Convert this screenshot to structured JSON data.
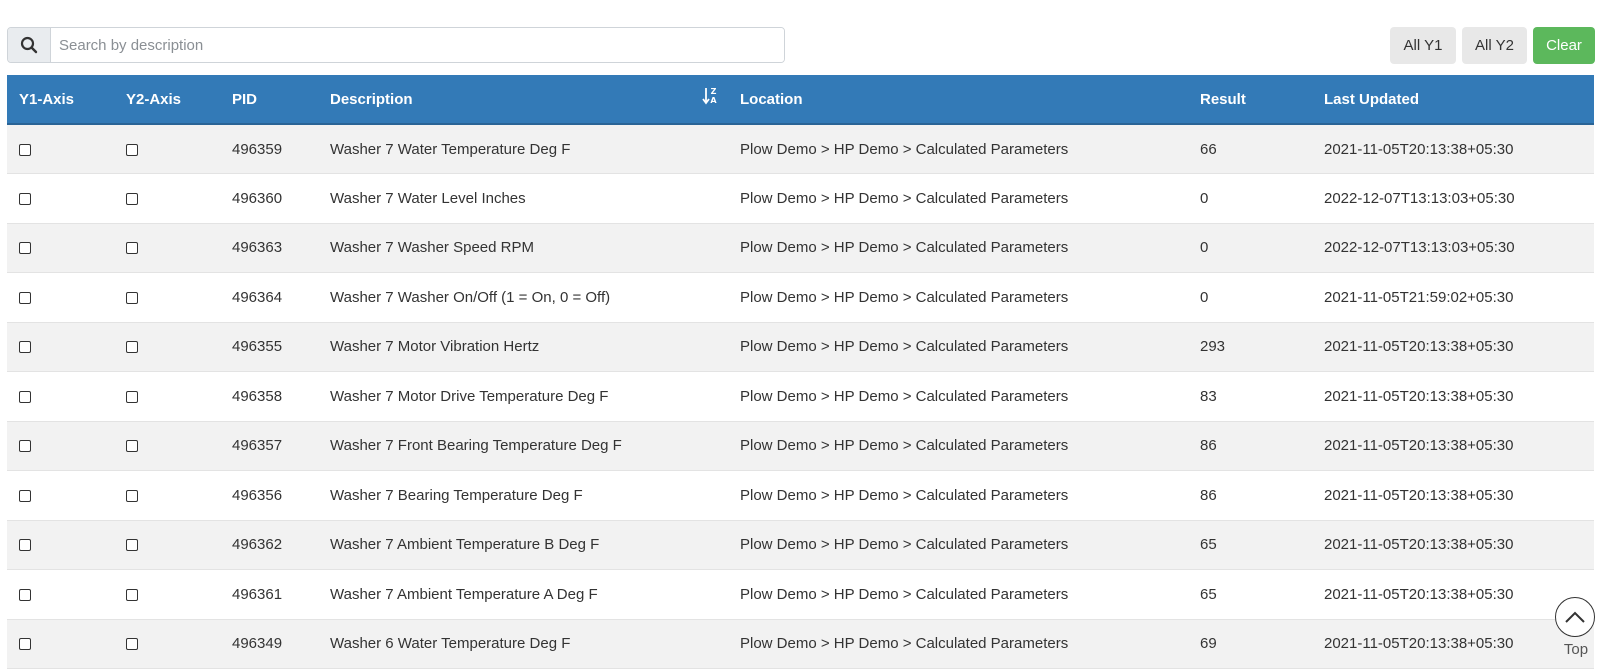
{
  "search": {
    "placeholder": "Search by description",
    "value": ""
  },
  "toolbar": {
    "all_y1_label": "All Y1",
    "all_y2_label": "All Y2",
    "clear_label": "Clear"
  },
  "table": {
    "headers": [
      "Y1-Axis",
      "Y2-Axis",
      "PID",
      "Description",
      "Location",
      "Result",
      "Last Updated"
    ],
    "sorted_column": "Description",
    "sort_direction": "descending",
    "rows": [
      {
        "pid": "496359",
        "description": "Washer 7 Water Temperature Deg F",
        "location": "Plow Demo > HP Demo > Calculated Parameters",
        "result": "66",
        "last_updated": "2021-11-05T20:13:38+05:30"
      },
      {
        "pid": "496360",
        "description": "Washer 7 Water Level Inches",
        "location": "Plow Demo > HP Demo > Calculated Parameters",
        "result": "0",
        "last_updated": "2022-12-07T13:13:03+05:30"
      },
      {
        "pid": "496363",
        "description": "Washer 7 Washer Speed RPM",
        "location": "Plow Demo > HP Demo > Calculated Parameters",
        "result": "0",
        "last_updated": "2022-12-07T13:13:03+05:30"
      },
      {
        "pid": "496364",
        "description": "Washer 7 Washer On/Off (1 = On, 0 = Off)",
        "location": "Plow Demo > HP Demo > Calculated Parameters",
        "result": "0",
        "last_updated": "2021-11-05T21:59:02+05:30"
      },
      {
        "pid": "496355",
        "description": "Washer 7 Motor Vibration Hertz",
        "location": "Plow Demo > HP Demo > Calculated Parameters",
        "result": "293",
        "last_updated": "2021-11-05T20:13:38+05:30"
      },
      {
        "pid": "496358",
        "description": "Washer 7 Motor Drive Temperature Deg F",
        "location": "Plow Demo > HP Demo > Calculated Parameters",
        "result": "83",
        "last_updated": "2021-11-05T20:13:38+05:30"
      },
      {
        "pid": "496357",
        "description": "Washer 7 Front Bearing Temperature Deg F",
        "location": "Plow Demo > HP Demo > Calculated Parameters",
        "result": "86",
        "last_updated": "2021-11-05T20:13:38+05:30"
      },
      {
        "pid": "496356",
        "description": "Washer 7 Bearing Temperature Deg F",
        "location": "Plow Demo > HP Demo > Calculated Parameters",
        "result": "86",
        "last_updated": "2021-11-05T20:13:38+05:30"
      },
      {
        "pid": "496362",
        "description": "Washer 7 Ambient Temperature B Deg F",
        "location": "Plow Demo > HP Demo > Calculated Parameters",
        "result": "65",
        "last_updated": "2021-11-05T20:13:38+05:30"
      },
      {
        "pid": "496361",
        "description": "Washer 7 Ambient Temperature A Deg F",
        "location": "Plow Demo > HP Demo > Calculated Parameters",
        "result": "65",
        "last_updated": "2021-11-05T20:13:38+05:30"
      },
      {
        "pid": "496349",
        "description": "Washer 6 Water Temperature Deg F",
        "location": "Plow Demo > HP Demo > Calculated Parameters",
        "result": "69",
        "last_updated": "2021-11-05T20:13:38+05:30"
      }
    ]
  },
  "scroll_top": {
    "label": "Top"
  },
  "colors": {
    "header_bg": "#337ab7",
    "clear_button": "#5cb85c",
    "row_stripe": "#f2f2f2"
  },
  "icons": {
    "search": "search-icon",
    "sort": "sort-descending-icon",
    "scroll_top": "chevron-up-icon"
  }
}
